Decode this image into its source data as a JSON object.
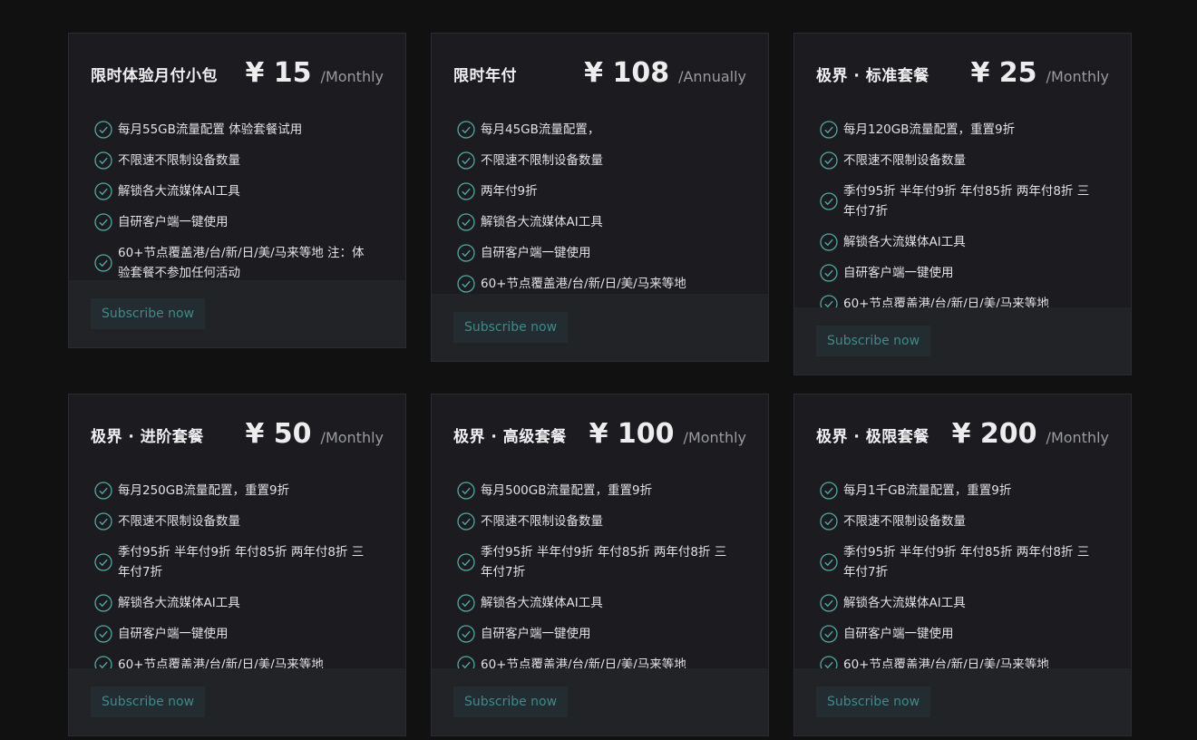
{
  "plans": [
    {
      "name": "限时体验月付小包",
      "price": "¥ 15",
      "period": "/Monthly",
      "features": [
        "每月55GB流量配置 体验套餐试用",
        "不限速不限制设备数量",
        "解锁各大流媒体AI工具",
        "自研客户端一键使用",
        "60+节点覆盖港/台/新/日/美/马来等地 注：体验套餐不参加任何活动"
      ],
      "button": "Subscribe now"
    },
    {
      "name": "限时年付",
      "price": "¥ 108",
      "period": "/Annually",
      "features": [
        "每月45GB流量配置，",
        "不限速不限制设备数量",
        "两年付9折",
        "解锁各大流媒体AI工具",
        "自研客户端一键使用",
        "60+节点覆盖港/台/新/日/美/马来等地"
      ],
      "button": "Subscribe now"
    },
    {
      "name": "极界 · 标准套餐",
      "price": "¥ 25",
      "period": "/Monthly",
      "features": [
        "每月120GB流量配置，重置9折",
        "不限速不限制设备数量",
        "季付95折 半年付9折 年付85折 两年付8折 三年付7折",
        "解锁各大流媒体AI工具",
        "自研客户端一键使用",
        "60+节点覆盖港/台/新/日/美/马来等地"
      ],
      "button": "Subscribe now"
    },
    {
      "name": "极界 · 进阶套餐",
      "price": "¥ 50",
      "period": "/Monthly",
      "features": [
        "每月250GB流量配置，重置9折",
        "不限速不限制设备数量",
        "季付95折 半年付9折 年付85折 两年付8折 三年付7折",
        "解锁各大流媒体AI工具",
        "自研客户端一键使用",
        "60+节点覆盖港/台/新/日/美/马来等地"
      ],
      "button": "Subscribe now"
    },
    {
      "name": "极界 · 高级套餐",
      "price": "¥ 100",
      "period": "/Monthly",
      "features": [
        "每月500GB流量配置，重置9折",
        "不限速不限制设备数量",
        "季付95折 半年付9折 年付85折 两年付8折 三年付7折",
        "解锁各大流媒体AI工具",
        "自研客户端一键使用",
        "60+节点覆盖港/台/新/日/美/马来等地"
      ],
      "button": "Subscribe now"
    },
    {
      "name": "极界 · 极限套餐",
      "price": "¥ 200",
      "period": "/Monthly",
      "features": [
        "每月1千GB流量配置，重置9折",
        "不限速不限制设备数量",
        "季付95折 半年付9折 年付85折 两年付8折 三年付7折",
        "解锁各大流媒体AI工具",
        "自研客户端一键使用",
        "60+节点覆盖港/台/新/日/美/马来等地"
      ],
      "button": "Subscribe now"
    }
  ],
  "colors": {
    "background": "#111112",
    "card": "#1b1b20",
    "card_footer": "#222326",
    "button_bg": "#232c30",
    "button_text": "#3f8a8a",
    "check": "#52a8a0"
  },
  "icons": {
    "feature": "check-circle-icon"
  }
}
